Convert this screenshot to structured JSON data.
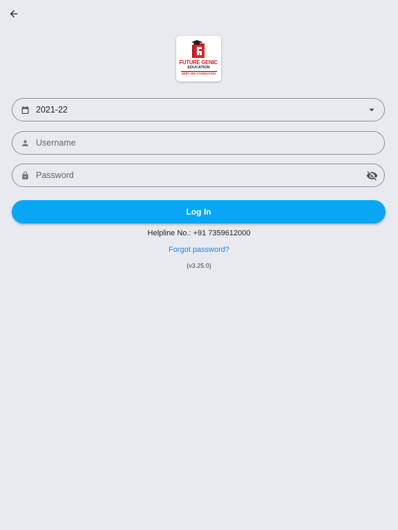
{
  "nav": {
    "back_icon": "arrow-back-icon"
  },
  "logo": {
    "line1": "FUTURE GENIC",
    "line2": "EDUCATION",
    "line3": "NEET-JEE-FOUNDATION",
    "brand_red": "#d8262c"
  },
  "form": {
    "session": {
      "icon": "calendar-icon",
      "value": "2021-22",
      "dropdown_icon": "arrow-drop-down-icon"
    },
    "username": {
      "icon": "person-icon",
      "placeholder": "Username",
      "value": ""
    },
    "password": {
      "icon": "lock-icon",
      "placeholder": "Password",
      "value": "",
      "toggle_icon": "visibility-off-icon"
    },
    "login_label": "Log In"
  },
  "footer": {
    "helpline": "Helpline No.: +91 7359612000",
    "forgot_password": "Forgot password?",
    "version": "(v3.25.0)"
  },
  "colors": {
    "background": "#e9eaef",
    "accent": "#08a7f5",
    "link": "#1e88d3"
  }
}
